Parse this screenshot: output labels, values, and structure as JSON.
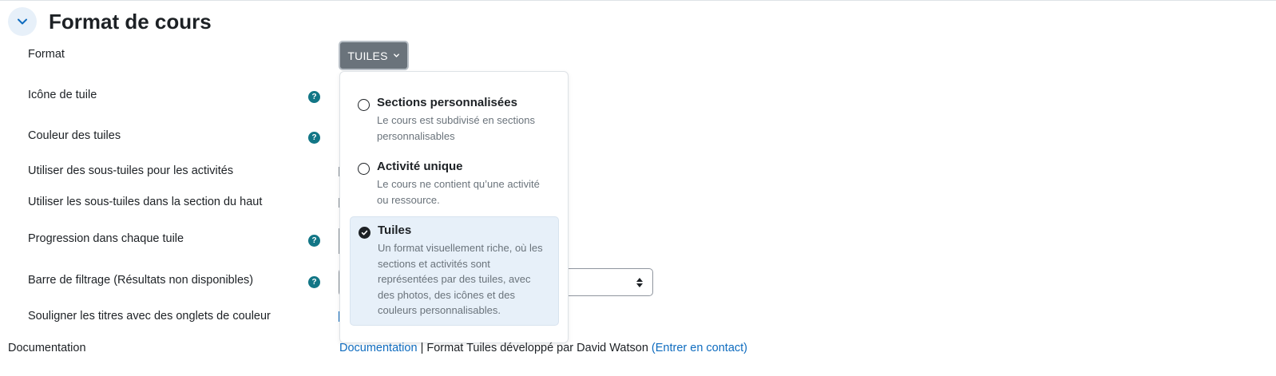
{
  "section": {
    "title": "Format de cours"
  },
  "fields": {
    "format": "Format",
    "tile_icon": "Icône de tuile",
    "tile_color": "Couleur des tuiles",
    "subtiles_activities": "Utiliser des sous-tuiles pour les activités",
    "subtiles_top": "Utiliser les sous-tuiles dans la section du haut",
    "progress": "Progression dans chaque tuile",
    "filter_bar": "Barre de filtrage (Résultats non disponibles)",
    "underline_titles": "Souligner les titres avec des onglets de couleur",
    "documentation": "Documentation"
  },
  "help_icon_glyph": "?",
  "format_button": {
    "label": "TUILES"
  },
  "dropdown": {
    "options": [
      {
        "title": "Sections personnalisées",
        "description": "Le cours est subdivisé en sections personnalisables",
        "selected": false
      },
      {
        "title": "Activité unique",
        "description": "Le cours ne contient qu’une activité ou ressource.",
        "selected": false
      },
      {
        "title": "Tuiles",
        "description": "Un format visuellement riche, où les sections et activités sont représentées par des tuiles, avec des photos, des icônes et des couleurs personnalisables.",
        "selected": true
      }
    ]
  },
  "documentation_line": {
    "link_label": "Documentation",
    "separator": "|",
    "text": "Format Tuiles développé par David Watson",
    "contact_label": "(Entrer en contact)"
  },
  "colors": {
    "accent": "#0f6cbf",
    "help": "#127686",
    "button_bg": "#6a737b",
    "selected_bg": "#e7f0f9"
  }
}
